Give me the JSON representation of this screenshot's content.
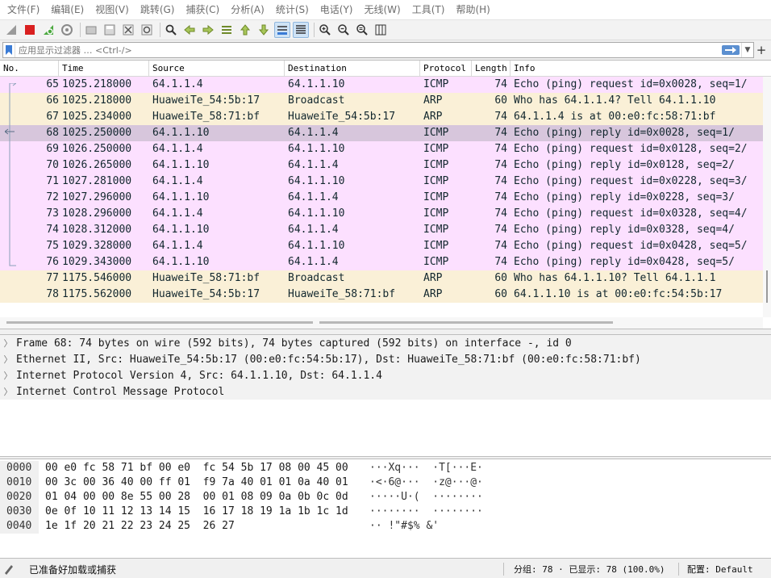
{
  "menu": [
    "文件(F)",
    "编辑(E)",
    "视图(V)",
    "跳转(G)",
    "捕获(C)",
    "分析(A)",
    "统计(S)",
    "电话(Y)",
    "无线(W)",
    "工具(T)",
    "帮助(H)"
  ],
  "toolbar": {
    "icons": [
      "shark-fin-start-icon",
      "stop-capture-icon",
      "restart-capture-icon",
      "capture-options-icon",
      "open-file-icon",
      "save-file-icon",
      "close-file-icon",
      "reload-file-icon",
      "find-packet-icon",
      "go-back-icon",
      "go-forward-icon",
      "go-to-packet-icon",
      "go-first-icon",
      "go-last-icon",
      "autoscroll-icon",
      "colorize-icon",
      "zoom-in-icon",
      "zoom-out-icon",
      "normal-size-icon",
      "resize-columns-icon"
    ]
  },
  "filter": {
    "placeholder": "应用显示过滤器 … <Ctrl-/>"
  },
  "packet_list": {
    "columns": [
      "No.",
      "Time",
      "Source",
      "Destination",
      "Protocol",
      "Length",
      "Info"
    ],
    "rows": [
      {
        "no": "65",
        "time": "1025.218000",
        "src": "64.1.1.4",
        "dst": "64.1.1.10",
        "proto": "ICMP",
        "len": "74",
        "info": "Echo (ping) request  id=0x0028, seq=1/",
        "kind": "icmp"
      },
      {
        "no": "66",
        "time": "1025.218000",
        "src": "HuaweiTe_54:5b:17",
        "dst": "Broadcast",
        "proto": "ARP",
        "len": "60",
        "info": "Who has 64.1.1.4? Tell 64.1.1.10",
        "kind": "arp"
      },
      {
        "no": "67",
        "time": "1025.234000",
        "src": "HuaweiTe_58:71:bf",
        "dst": "HuaweiTe_54:5b:17",
        "proto": "ARP",
        "len": "74",
        "info": "64.1.1.4 is at 00:e0:fc:58:71:bf",
        "kind": "arp"
      },
      {
        "no": "68",
        "time": "1025.250000",
        "src": "64.1.1.10",
        "dst": "64.1.1.4",
        "proto": "ICMP",
        "len": "74",
        "info": "Echo (ping) reply    id=0x0028, seq=1/",
        "kind": "selected"
      },
      {
        "no": "69",
        "time": "1026.250000",
        "src": "64.1.1.4",
        "dst": "64.1.1.10",
        "proto": "ICMP",
        "len": "74",
        "info": "Echo (ping) request  id=0x0128, seq=2/",
        "kind": "icmp"
      },
      {
        "no": "70",
        "time": "1026.265000",
        "src": "64.1.1.10",
        "dst": "64.1.1.4",
        "proto": "ICMP",
        "len": "74",
        "info": "Echo (ping) reply    id=0x0128, seq=2/",
        "kind": "icmp"
      },
      {
        "no": "71",
        "time": "1027.281000",
        "src": "64.1.1.4",
        "dst": "64.1.1.10",
        "proto": "ICMP",
        "len": "74",
        "info": "Echo (ping) request  id=0x0228, seq=3/",
        "kind": "icmp"
      },
      {
        "no": "72",
        "time": "1027.296000",
        "src": "64.1.1.10",
        "dst": "64.1.1.4",
        "proto": "ICMP",
        "len": "74",
        "info": "Echo (ping) reply    id=0x0228, seq=3/",
        "kind": "icmp"
      },
      {
        "no": "73",
        "time": "1028.296000",
        "src": "64.1.1.4",
        "dst": "64.1.1.10",
        "proto": "ICMP",
        "len": "74",
        "info": "Echo (ping) request  id=0x0328, seq=4/",
        "kind": "icmp"
      },
      {
        "no": "74",
        "time": "1028.312000",
        "src": "64.1.1.10",
        "dst": "64.1.1.4",
        "proto": "ICMP",
        "len": "74",
        "info": "Echo (ping) reply    id=0x0328, seq=4/",
        "kind": "icmp"
      },
      {
        "no": "75",
        "time": "1029.328000",
        "src": "64.1.1.4",
        "dst": "64.1.1.10",
        "proto": "ICMP",
        "len": "74",
        "info": "Echo (ping) request  id=0x0428, seq=5/",
        "kind": "icmp"
      },
      {
        "no": "76",
        "time": "1029.343000",
        "src": "64.1.1.10",
        "dst": "64.1.1.4",
        "proto": "ICMP",
        "len": "74",
        "info": "Echo (ping) reply    id=0x0428, seq=5/",
        "kind": "icmp"
      },
      {
        "no": "77",
        "time": "1175.546000",
        "src": "HuaweiTe_58:71:bf",
        "dst": "Broadcast",
        "proto": "ARP",
        "len": "60",
        "info": "Who has 64.1.1.10? Tell 64.1.1.1",
        "kind": "arp"
      },
      {
        "no": "78",
        "time": "1175.562000",
        "src": "HuaweiTe_54:5b:17",
        "dst": "HuaweiTe_58:71:bf",
        "proto": "ARP",
        "len": "60",
        "info": "64.1.1.10 is at 00:e0:fc:54:5b:17",
        "kind": "arp"
      }
    ]
  },
  "details": [
    "Frame 68: 74 bytes on wire (592 bits), 74 bytes captured (592 bits) on interface -, id 0",
    "Ethernet II, Src: HuaweiTe_54:5b:17 (00:e0:fc:54:5b:17), Dst: HuaweiTe_58:71:bf (00:e0:fc:58:71:bf)",
    "Internet Protocol Version 4, Src: 64.1.1.10, Dst: 64.1.1.4",
    "Internet Control Message Protocol"
  ],
  "bytes": [
    {
      "offset": "0000",
      "hex": "00 e0 fc 58 71 bf 00 e0  fc 54 5b 17 08 00 45 00",
      "ascii": "···Xq···  ·T[···E·"
    },
    {
      "offset": "0010",
      "hex": "00 3c 00 36 40 00 ff 01  f9 7a 40 01 01 0a 40 01",
      "ascii": "·<·6@···  ·z@···@·"
    },
    {
      "offset": "0020",
      "hex": "01 04 00 00 8e 55 00 28  00 01 08 09 0a 0b 0c 0d",
      "ascii": "·····U·(  ········"
    },
    {
      "offset": "0030",
      "hex": "0e 0f 10 11 12 13 14 15  16 17 18 19 1a 1b 1c 1d",
      "ascii": "········  ········"
    },
    {
      "offset": "0040",
      "hex": "1e 1f 20 21 22 23 24 25  26 27",
      "ascii": "·· !\"#$% &'"
    }
  ],
  "status": {
    "ready": "已准备好加载或捕获",
    "stats": "分组: 78 · 已显示: 78 (100.0%)",
    "profile": "配置: Default"
  },
  "colors": {
    "icmp_row": "#fce0ff",
    "arp_row": "#faf0d7",
    "selected_row": "#d7c6dc",
    "stop_button": "#d92020",
    "accent": "#5b8fd0"
  }
}
